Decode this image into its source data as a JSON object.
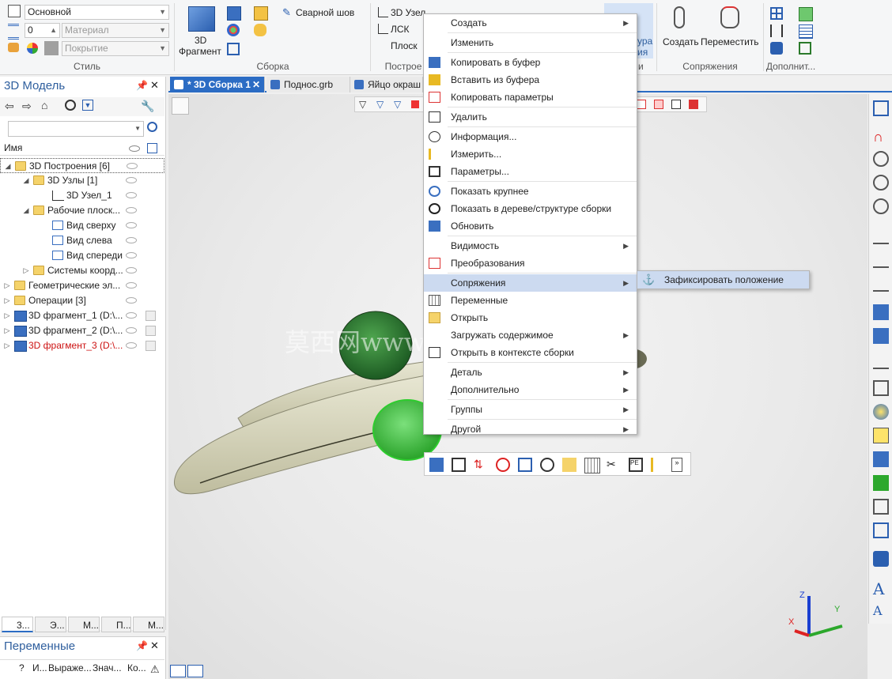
{
  "ribbon": {
    "style": {
      "layer_value": "Основной",
      "layer_number": "0",
      "material_placeholder": "Материал",
      "coating_placeholder": "Покрытие",
      "group_title": "Стиль"
    },
    "assembly": {
      "fragment_label": "3D\nФрагмент",
      "fragment_line1": "3D",
      "fragment_line2": "Фрагмент",
      "weld_label": "Сварной шов",
      "group_title": "Сборка"
    },
    "construct": {
      "node_label": "3D Узел",
      "lcs_label": "ЛСК",
      "plane_label": "Плоск",
      "group_title": "Построе"
    },
    "partial": {
      "text1": "ура",
      "text2": "ия",
      "text3": "и"
    },
    "mates": {
      "create_label": "Создать",
      "move_label": "Переместить",
      "group_title": "Сопряжения"
    },
    "extra": {
      "group_title": "Дополнит..."
    }
  },
  "tabs": [
    {
      "label": "* 3D Сборка 1",
      "active": true
    },
    {
      "label": "Поднос.grb",
      "active": false
    },
    {
      "label": "Яйцо окраш",
      "active": false
    }
  ],
  "left_panel": {
    "title": "3D Модель",
    "search_placeholder": "",
    "column_name": "Имя",
    "tree": [
      {
        "label": "3D Построения [6]",
        "level": 0,
        "expanded": true,
        "type": "folder"
      },
      {
        "label": "3D Узлы [1]",
        "level": 1,
        "expanded": true,
        "type": "folder"
      },
      {
        "label": "3D Узел_1",
        "level": 2,
        "type": "node"
      },
      {
        "label": "Рабочие плоск...",
        "level": 1,
        "expanded": true,
        "type": "folder"
      },
      {
        "label": "Вид сверху",
        "level": 2,
        "type": "plane"
      },
      {
        "label": "Вид слева",
        "level": 2,
        "type": "plane"
      },
      {
        "label": "Вид спереди",
        "level": 2,
        "type": "plane"
      },
      {
        "label": "Системы коорд...",
        "level": 1,
        "expanded": false,
        "type": "folder"
      },
      {
        "label": "Геометрические эл...",
        "level": 0,
        "expanded": false,
        "type": "folder"
      },
      {
        "label": "Операции [3]",
        "level": 0,
        "expanded": false,
        "type": "folder"
      },
      {
        "label": "3D фрагмент_1 (D:\\...",
        "level": 0,
        "expanded": false,
        "type": "fragment"
      },
      {
        "label": "3D фрагмент_2 (D:\\...",
        "level": 0,
        "expanded": false,
        "type": "fragment"
      },
      {
        "label": "3D фрагмент_3 (D:\\...",
        "level": 0,
        "expanded": false,
        "type": "fragment",
        "color": "#cc1111"
      }
    ],
    "bottom_tabs": [
      "3...",
      "Э...",
      "М...",
      "П...",
      "М..."
    ]
  },
  "variables_panel": {
    "title": "Переменные",
    "columns": [
      "?",
      "И...",
      "Выраже...",
      "Знач...",
      "Ко..."
    ]
  },
  "context_menu": {
    "items": [
      {
        "label": "Создать",
        "submenu": true,
        "icon": "none"
      },
      {
        "label": "Изменить",
        "submenu": false,
        "icon": "edit-icon"
      },
      {
        "label": "Копировать в буфер",
        "submenu": false,
        "icon": "copy-icon"
      },
      {
        "label": "Вставить из буфера",
        "submenu": false,
        "icon": "paste-icon"
      },
      {
        "label": "Копировать параметры",
        "submenu": false,
        "icon": "copy-params-icon"
      },
      {
        "label": "Удалить",
        "submenu": false,
        "icon": "trash-icon"
      },
      {
        "label": "Информация...",
        "submenu": false,
        "icon": "info-icon"
      },
      {
        "label": "Измерить...",
        "submenu": false,
        "icon": "measure-icon"
      },
      {
        "label": "Параметры...",
        "submenu": false,
        "icon": "params-icon"
      },
      {
        "label": "Показать крупнее",
        "submenu": false,
        "icon": "zoom-icon"
      },
      {
        "label": "Показать в дереве/структуре сборки",
        "submenu": false,
        "icon": "target-icon"
      },
      {
        "label": "Обновить",
        "submenu": false,
        "icon": "refresh-icon"
      },
      {
        "label": "Видимость",
        "submenu": true,
        "icon": "none"
      },
      {
        "label": "Преобразования",
        "submenu": false,
        "icon": "transform-icon"
      },
      {
        "label": "Сопряжения",
        "submenu": true,
        "icon": "none",
        "highlighted": true
      },
      {
        "label": "Переменные",
        "submenu": false,
        "icon": "calculator-icon"
      },
      {
        "label": "Открыть",
        "submenu": false,
        "icon": "folder-open-icon"
      },
      {
        "label": "Загружать содержимое",
        "submenu": true,
        "icon": "none"
      },
      {
        "label": "Открыть в контексте сборки",
        "submenu": false,
        "icon": "context-open-icon"
      },
      {
        "label": "Деталь",
        "submenu": true,
        "icon": "none"
      },
      {
        "label": "Дополнительно",
        "submenu": true,
        "icon": "none"
      },
      {
        "label": "Группы",
        "submenu": true,
        "icon": "none"
      },
      {
        "label": "Другой",
        "submenu": true,
        "icon": "none"
      }
    ],
    "submenu_item": "Зафиксировать положение"
  },
  "viewport": {
    "watermark": "莫西网www"
  },
  "axes": {
    "z": "Z",
    "y": "Y",
    "x": "X"
  },
  "colors": {
    "accent": "#2b6cc4",
    "highlight": "#ccdaf0",
    "error_red": "#cc1111"
  }
}
